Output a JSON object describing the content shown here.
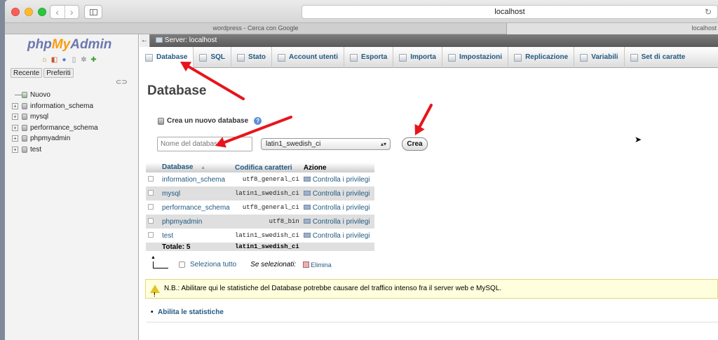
{
  "browser": {
    "url": "localhost",
    "tabs": [
      {
        "label": "wordpress - Cerca con Google"
      },
      {
        "label": "localhost"
      }
    ]
  },
  "leftnav": {
    "logo_php": "php",
    "logo_my": "My",
    "logo_admin": "Admin",
    "recent_label": "Recente",
    "favorites_label": "Preferiti",
    "tree": [
      {
        "label": "Nuovo"
      },
      {
        "label": "information_schema"
      },
      {
        "label": "mysql"
      },
      {
        "label": "performance_schema"
      },
      {
        "label": "phpmyadmin"
      },
      {
        "label": "test"
      }
    ]
  },
  "serverbar": {
    "label": "Server: localhost"
  },
  "menu": [
    {
      "label": "Database"
    },
    {
      "label": "SQL"
    },
    {
      "label": "Stato"
    },
    {
      "label": "Account utenti"
    },
    {
      "label": "Esporta"
    },
    {
      "label": "Importa"
    },
    {
      "label": "Impostazioni"
    },
    {
      "label": "Replicazione"
    },
    {
      "label": "Variabili"
    },
    {
      "label": "Set di caratte"
    }
  ],
  "main": {
    "title": "Database",
    "create_heading": "Crea un nuovo database",
    "dbname_placeholder": "Nome del database",
    "collation_selected": "latin1_swedish_ci",
    "create_button": "Crea"
  },
  "table": {
    "headers": [
      "Database",
      "Codifica caratteri",
      "Azione"
    ],
    "sort_indicator": "▲",
    "rows": [
      {
        "name": "information_schema",
        "collation": "utf8_general_ci",
        "action": "Controlla i privilegi"
      },
      {
        "name": "mysql",
        "collation": "latin1_swedish_ci",
        "action": "Controlla i privilegi"
      },
      {
        "name": "performance_schema",
        "collation": "utf8_general_ci",
        "action": "Controlla i privilegi"
      },
      {
        "name": "phpmyadmin",
        "collation": "utf8_bin",
        "action": "Controlla i privilegi"
      },
      {
        "name": "test",
        "collation": "latin1_swedish_ci",
        "action": "Controlla i privilegi"
      }
    ],
    "total_label": "Totale: 5",
    "total_collation": "latin1_swedish_ci"
  },
  "bulk": {
    "select_all": "Seleziona tutto",
    "with_selected": "Se selezionati:",
    "delete": "Elimina"
  },
  "notice": {
    "text": "N.B.: Abilitare qui le statistiche del Database potrebbe causare del traffico intenso fra il server web e MySQL."
  },
  "stats_link": "Abilita le statistiche",
  "annotation_color": "#e8141b"
}
